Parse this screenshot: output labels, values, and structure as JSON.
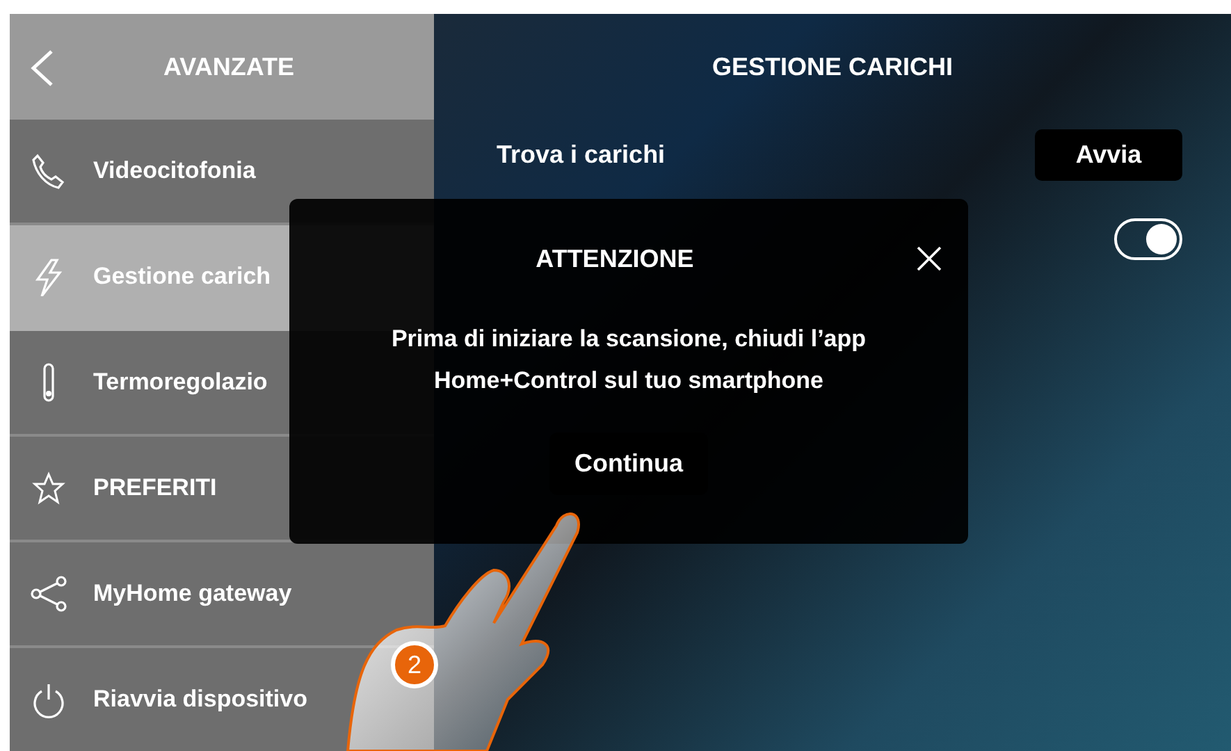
{
  "sidebar": {
    "title": "AVANZATE",
    "items": [
      {
        "kind": "phone",
        "label": "Videocitofonia",
        "selected": false
      },
      {
        "kind": "bolt",
        "label": "Gestione carich",
        "selected": true
      },
      {
        "kind": "thermometer",
        "label": "Termoregolazio",
        "selected": false
      },
      {
        "kind": "star",
        "label": "PREFERITI",
        "selected": false
      },
      {
        "kind": "share",
        "label": "MyHome gateway",
        "selected": false
      },
      {
        "kind": "power",
        "label": "Riavvia dispositivo",
        "selected": false
      }
    ]
  },
  "main": {
    "title": "GESTIONE CARICHI",
    "rows": [
      {
        "kind": "button",
        "label": "Trova i carichi",
        "button": "Avvia"
      },
      {
        "kind": "toggle",
        "on": true
      }
    ]
  },
  "dialog": {
    "title": "ATTENZIONE",
    "message": "Prima di iniziare la scansione, chiudi l’app Home+Control sul tuo smartphone",
    "button": "Continua"
  },
  "step_badge": "2"
}
